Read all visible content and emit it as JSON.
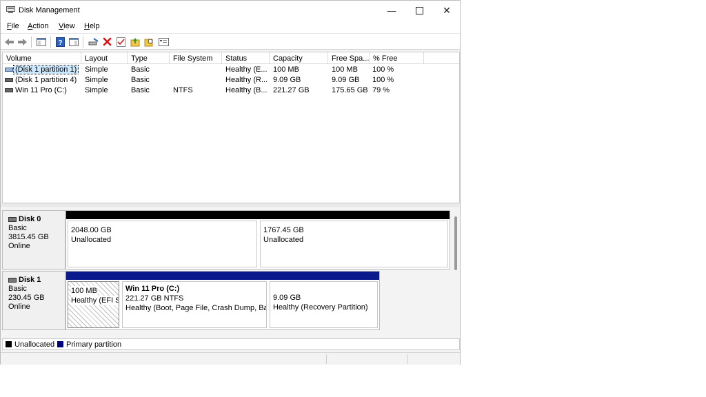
{
  "window": {
    "title": "Disk Management"
  },
  "menu": [
    {
      "label": "File",
      "key": "F",
      "rest": "ile"
    },
    {
      "label": "Action",
      "key": "A",
      "rest": "ction"
    },
    {
      "label": "View",
      "key": "V",
      "rest": "iew"
    },
    {
      "label": "Help",
      "key": "H",
      "rest": "elp"
    }
  ],
  "columns": [
    "Volume",
    "Layout",
    "Type",
    "File System",
    "Status",
    "Capacity",
    "Free Spa...",
    "% Free"
  ],
  "volumes": [
    {
      "volume": "(Disk 1 partition 1)",
      "layout": "Simple",
      "type": "Basic",
      "fs": "",
      "status": "Healthy (E...",
      "capacity": "100 MB",
      "free": "100 MB",
      "pct": "100 %"
    },
    {
      "volume": "(Disk 1 partition 4)",
      "layout": "Simple",
      "type": "Basic",
      "fs": "",
      "status": "Healthy (R...",
      "capacity": "9.09 GB",
      "free": "9.09 GB",
      "pct": "100 %"
    },
    {
      "volume": "Win 11 Pro (C:)",
      "layout": "Simple",
      "type": "Basic",
      "fs": "NTFS",
      "status": "Healthy (B...",
      "capacity": "221.27 GB",
      "free": "175.65 GB",
      "pct": "79 %"
    }
  ],
  "disks": [
    {
      "name": "Disk 0",
      "kind": "Basic",
      "size": "3815.45 GB",
      "state": "Online",
      "partitions": [
        {
          "title": "",
          "line1": "2048.00 GB",
          "line2": "Unallocated"
        },
        {
          "title": "",
          "line1": "1767.45 GB",
          "line2": "Unallocated"
        }
      ]
    },
    {
      "name": "Disk 1",
      "kind": "Basic",
      "size": "230.45 GB",
      "state": "Online",
      "partitions": [
        {
          "title": "",
          "line1": "100 MB",
          "line2": "Healthy (EFI Sy"
        },
        {
          "title": "Win 11 Pro  (C:)",
          "line1": "221.27 GB NTFS",
          "line2": "Healthy (Boot, Page File, Crash Dump, Basi"
        },
        {
          "title": "",
          "line1": "9.09 GB",
          "line2": "Healthy (Recovery Partition)"
        }
      ]
    }
  ],
  "legend": [
    {
      "label": "Unallocated",
      "color": "#000000"
    },
    {
      "label": "Primary partition",
      "color": "#00007f"
    }
  ],
  "colors": {
    "unallocated": "#000000",
    "primary": "#0a1a8c",
    "selection": "#cce8ff"
  },
  "icons": {
    "app": "disk-management-icon",
    "min": "minimize-icon",
    "max": "maximize-icon",
    "close": "close-icon"
  }
}
